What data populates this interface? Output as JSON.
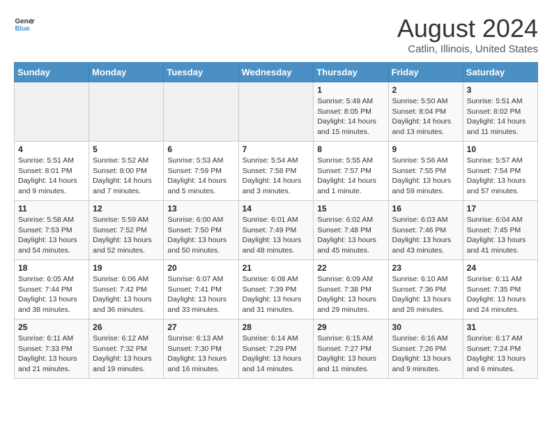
{
  "logo": {
    "text_general": "General",
    "text_blue": "Blue"
  },
  "header": {
    "month": "August 2024",
    "location": "Catlin, Illinois, United States"
  },
  "days_of_week": [
    "Sunday",
    "Monday",
    "Tuesday",
    "Wednesday",
    "Thursday",
    "Friday",
    "Saturday"
  ],
  "weeks": [
    [
      {
        "day": "",
        "info": ""
      },
      {
        "day": "",
        "info": ""
      },
      {
        "day": "",
        "info": ""
      },
      {
        "day": "",
        "info": ""
      },
      {
        "day": "1",
        "info": "Sunrise: 5:49 AM\nSunset: 8:05 PM\nDaylight: 14 hours and 15 minutes."
      },
      {
        "day": "2",
        "info": "Sunrise: 5:50 AM\nSunset: 8:04 PM\nDaylight: 14 hours and 13 minutes."
      },
      {
        "day": "3",
        "info": "Sunrise: 5:51 AM\nSunset: 8:02 PM\nDaylight: 14 hours and 11 minutes."
      }
    ],
    [
      {
        "day": "4",
        "info": "Sunrise: 5:51 AM\nSunset: 8:01 PM\nDaylight: 14 hours and 9 minutes."
      },
      {
        "day": "5",
        "info": "Sunrise: 5:52 AM\nSunset: 8:00 PM\nDaylight: 14 hours and 7 minutes."
      },
      {
        "day": "6",
        "info": "Sunrise: 5:53 AM\nSunset: 7:59 PM\nDaylight: 14 hours and 5 minutes."
      },
      {
        "day": "7",
        "info": "Sunrise: 5:54 AM\nSunset: 7:58 PM\nDaylight: 14 hours and 3 minutes."
      },
      {
        "day": "8",
        "info": "Sunrise: 5:55 AM\nSunset: 7:57 PM\nDaylight: 14 hours and 1 minute."
      },
      {
        "day": "9",
        "info": "Sunrise: 5:56 AM\nSunset: 7:55 PM\nDaylight: 13 hours and 59 minutes."
      },
      {
        "day": "10",
        "info": "Sunrise: 5:57 AM\nSunset: 7:54 PM\nDaylight: 13 hours and 57 minutes."
      }
    ],
    [
      {
        "day": "11",
        "info": "Sunrise: 5:58 AM\nSunset: 7:53 PM\nDaylight: 13 hours and 54 minutes."
      },
      {
        "day": "12",
        "info": "Sunrise: 5:59 AM\nSunset: 7:52 PM\nDaylight: 13 hours and 52 minutes."
      },
      {
        "day": "13",
        "info": "Sunrise: 6:00 AM\nSunset: 7:50 PM\nDaylight: 13 hours and 50 minutes."
      },
      {
        "day": "14",
        "info": "Sunrise: 6:01 AM\nSunset: 7:49 PM\nDaylight: 13 hours and 48 minutes."
      },
      {
        "day": "15",
        "info": "Sunrise: 6:02 AM\nSunset: 7:48 PM\nDaylight: 13 hours and 45 minutes."
      },
      {
        "day": "16",
        "info": "Sunrise: 6:03 AM\nSunset: 7:46 PM\nDaylight: 13 hours and 43 minutes."
      },
      {
        "day": "17",
        "info": "Sunrise: 6:04 AM\nSunset: 7:45 PM\nDaylight: 13 hours and 41 minutes."
      }
    ],
    [
      {
        "day": "18",
        "info": "Sunrise: 6:05 AM\nSunset: 7:44 PM\nDaylight: 13 hours and 38 minutes."
      },
      {
        "day": "19",
        "info": "Sunrise: 6:06 AM\nSunset: 7:42 PM\nDaylight: 13 hours and 36 minutes."
      },
      {
        "day": "20",
        "info": "Sunrise: 6:07 AM\nSunset: 7:41 PM\nDaylight: 13 hours and 33 minutes."
      },
      {
        "day": "21",
        "info": "Sunrise: 6:08 AM\nSunset: 7:39 PM\nDaylight: 13 hours and 31 minutes."
      },
      {
        "day": "22",
        "info": "Sunrise: 6:09 AM\nSunset: 7:38 PM\nDaylight: 13 hours and 29 minutes."
      },
      {
        "day": "23",
        "info": "Sunrise: 6:10 AM\nSunset: 7:36 PM\nDaylight: 13 hours and 26 minutes."
      },
      {
        "day": "24",
        "info": "Sunrise: 6:11 AM\nSunset: 7:35 PM\nDaylight: 13 hours and 24 minutes."
      }
    ],
    [
      {
        "day": "25",
        "info": "Sunrise: 6:11 AM\nSunset: 7:33 PM\nDaylight: 13 hours and 21 minutes."
      },
      {
        "day": "26",
        "info": "Sunrise: 6:12 AM\nSunset: 7:32 PM\nDaylight: 13 hours and 19 minutes."
      },
      {
        "day": "27",
        "info": "Sunrise: 6:13 AM\nSunset: 7:30 PM\nDaylight: 13 hours and 16 minutes."
      },
      {
        "day": "28",
        "info": "Sunrise: 6:14 AM\nSunset: 7:29 PM\nDaylight: 13 hours and 14 minutes."
      },
      {
        "day": "29",
        "info": "Sunrise: 6:15 AM\nSunset: 7:27 PM\nDaylight: 13 hours and 11 minutes."
      },
      {
        "day": "30",
        "info": "Sunrise: 6:16 AM\nSunset: 7:26 PM\nDaylight: 13 hours and 9 minutes."
      },
      {
        "day": "31",
        "info": "Sunrise: 6:17 AM\nSunset: 7:24 PM\nDaylight: 13 hours and 6 minutes."
      }
    ]
  ]
}
